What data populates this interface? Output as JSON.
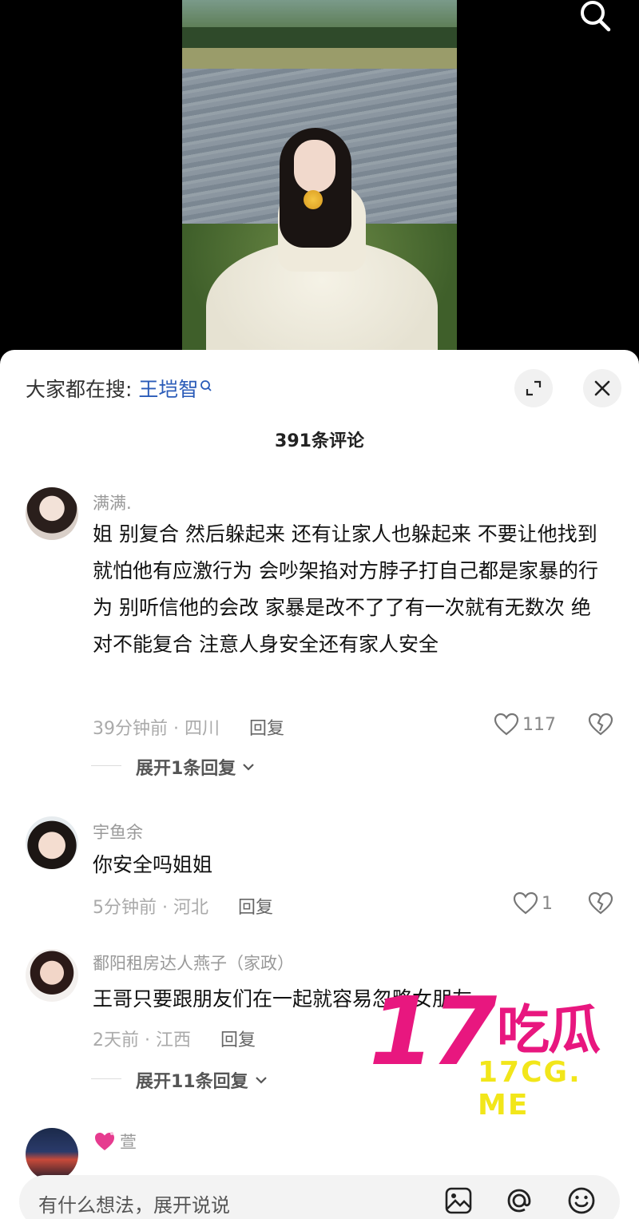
{
  "search_hint": {
    "prefix": "大家都在搜:",
    "keyword": "王垲智"
  },
  "comment_count": "391条评论",
  "comments": [
    {
      "username": "满满.",
      "text": "姐 别复合 然后躲起来 还有让家人也躲起来 不要让他找到 就怕他有应激行为 会吵架掐对方脖子打自己都是家暴的行为 别听信他的会改 家暴是改不了了有一次就有无数次 绝对不能复合 注意人身安全还有家人安全",
      "meta": "39分钟前 · 四川",
      "reply_label": "回复",
      "likes": "117",
      "expand": "展开1条回复"
    },
    {
      "username": "宇鱼余",
      "text": "你安全吗姐姐",
      "meta": "5分钟前 · 河北",
      "reply_label": "回复",
      "likes": "1"
    },
    {
      "username": "鄱阳租房达人燕子（家政）",
      "text": "王哥只要跟朋友们在一起就容易忽略女朋友",
      "meta": "2天前 · 江西",
      "reply_label": "回复",
      "expand": "展开11条回复"
    },
    {
      "username": "萱"
    }
  ],
  "input": {
    "placeholder": "有什么想法，展开说说"
  },
  "watermark": {
    "number": "17",
    "chinese": "吃瓜",
    "url": "17CG. ME"
  },
  "icons": [
    "search-icon",
    "expand-icon",
    "close-icon",
    "heart-icon",
    "broken-heart-icon",
    "chevron-down-icon",
    "image-icon",
    "at-icon",
    "emoji-icon"
  ]
}
